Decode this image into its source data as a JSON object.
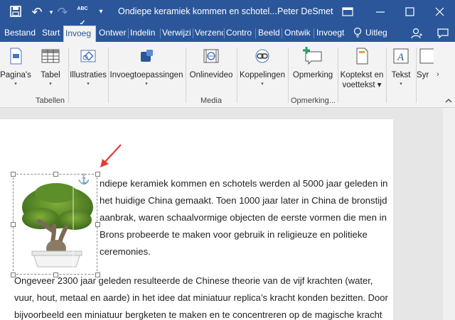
{
  "window": {
    "title": "Ondiepe keramiek kommen en schotel...",
    "user": "Peter DeSmet",
    "undo_label": "↶",
    "redo_label": "↷",
    "abc_label": "ABC",
    "qat_more_label": "▾"
  },
  "tabs": [
    {
      "label": "Bestand"
    },
    {
      "label": "Start"
    },
    {
      "label": "Invoeg"
    },
    {
      "label": "Ontwer"
    },
    {
      "label": "Indelin"
    },
    {
      "label": "Verwijzi"
    },
    {
      "label": "Verzend"
    },
    {
      "label": "Contro"
    },
    {
      "label": "Beeld"
    },
    {
      "label": "Ontwik"
    },
    {
      "label": "Invoegt"
    }
  ],
  "tell_me": "Uitleg",
  "ribbon": {
    "buttons": [
      {
        "label": "Pagina's",
        "caret": "▾",
        "icon": "pages-icon"
      },
      {
        "label": "Tabel",
        "caret": "▾",
        "icon": "table-icon"
      },
      {
        "label": "Illustraties",
        "caret": "▾",
        "icon": "illustrations-icon"
      },
      {
        "label": "Invoegtoepassingen",
        "caret": "▾",
        "icon": "addins-icon"
      },
      {
        "label": "Onlinevideo",
        "caret": "",
        "icon": "video-icon"
      },
      {
        "label": "Koppelingen",
        "caret": "▾",
        "icon": "links-icon"
      },
      {
        "label": "Opmerking",
        "caret": "",
        "icon": "comment-icon"
      },
      {
        "label": "Koptekst en",
        "label2": "voettekst ▾",
        "icon": "header-footer-icon"
      },
      {
        "label": "Tekst",
        "caret": "▾",
        "icon": "text-icon"
      },
      {
        "label": "Syr",
        "caret": "",
        "icon": "symbols-icon"
      }
    ],
    "groups": [
      "Tabellen",
      "Media",
      "Opmerking..."
    ]
  },
  "document": {
    "lines": [
      "ndiepe keramiek kommen en schotels werden al 5000 jaar geleden in",
      "het huidige China gemaakt. Toen 1000 jaar later in China de bronstijd",
      "aanbrak, waren schaalvormige objecten de eerste vormen die men in",
      "Brons probeerde te maken voor gebruik in religieuze en politieke",
      "ceremonies.",
      "Ongeveer 2300 jaar geleden resulteerde de Chinese theorie van de vijf krachten (water,",
      "vuur, hout, metaal en aarde) in het idee dat miniatuur replica’s kracht konden bezitten. Door",
      "bijvoorbeeld een miniatuur bergketen te maken en te concentreren op de magische kracht"
    ]
  },
  "colors": {
    "accent": "#2b579a",
    "arrow": "#e53935"
  }
}
